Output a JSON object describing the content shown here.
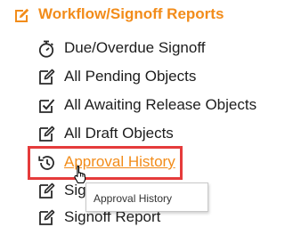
{
  "section": {
    "title": "Workflow/Signoff Reports",
    "icon": "report-edit-icon",
    "accent_color": "#f28c1a"
  },
  "items": [
    {
      "label": "Due/Overdue Signoff",
      "icon": "timer-icon"
    },
    {
      "label": "All Pending Objects",
      "icon": "document-edit-icon"
    },
    {
      "label": "All Awaiting Release Objects",
      "icon": "checkbox-checked-icon"
    },
    {
      "label": "All Draft Objects",
      "icon": "document-edit-icon"
    },
    {
      "label": "Approval History",
      "icon": "history-icon",
      "active": true
    },
    {
      "label": "Signoff Reports",
      "icon": "document-edit-icon"
    },
    {
      "label": "Signoff Report",
      "icon": "document-edit-icon"
    }
  ],
  "tooltip": {
    "text": "Approval History"
  },
  "highlight_color": "#e53b3b"
}
